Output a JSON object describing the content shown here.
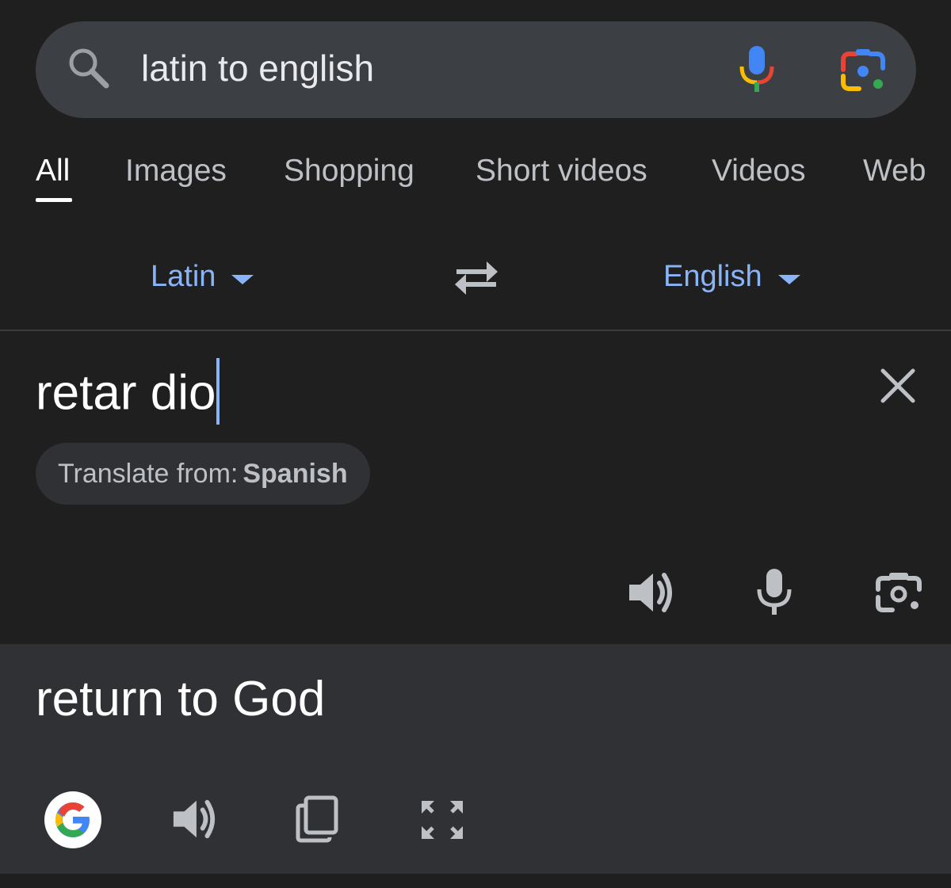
{
  "search": {
    "query": "latin to english",
    "icons": {
      "search": "search-icon",
      "voice": "mic-icon",
      "lens": "google-lens-icon"
    }
  },
  "tabs": [
    {
      "label": "All",
      "active": true
    },
    {
      "label": "Images",
      "active": false
    },
    {
      "label": "Shopping",
      "active": false
    },
    {
      "label": "Short videos",
      "active": false
    },
    {
      "label": "Videos",
      "active": false
    },
    {
      "label": "Web",
      "active": false
    }
  ],
  "translator": {
    "source_language": "Latin",
    "target_language": "English",
    "source_text": "retar dio",
    "detect_label": "Translate from:",
    "detected_language": "Spanish",
    "translated_text": "return to God",
    "source_icons": [
      "speaker-icon",
      "mic-icon",
      "camera-icon"
    ],
    "output_icons": [
      "google-logo",
      "speaker-icon",
      "copy-icon",
      "fullscreen-icon"
    ]
  },
  "colors": {
    "background": "#1f1f1f",
    "search_bar": "#3c3f43",
    "output_panel": "#303134",
    "accent_blue": "#8ab4f8",
    "tab_inactive": "#bdc1c6"
  }
}
